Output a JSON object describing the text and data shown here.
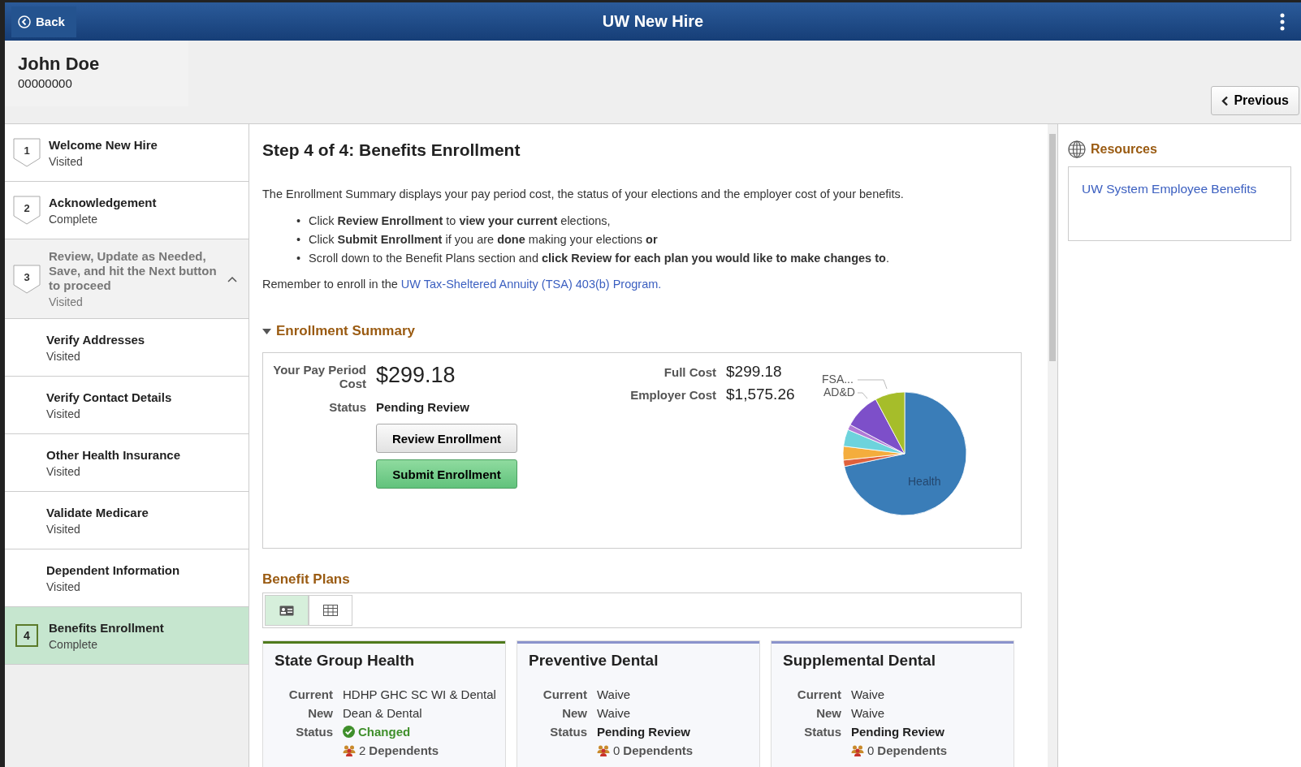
{
  "header": {
    "back": "Back",
    "title": "UW New Hire"
  },
  "person": {
    "name": "John Doe",
    "id": "00000000"
  },
  "previous": "Previous",
  "steps": [
    {
      "number": "1",
      "title": "Welcome New Hire",
      "status": "Visited",
      "selected": false,
      "expanded": false
    },
    {
      "number": "2",
      "title": "Acknowledgement",
      "status": "Complete",
      "selected": false,
      "expanded": false
    },
    {
      "number": "3",
      "title": "Review, Update as Needed, Save, and hit the Next button to proceed",
      "status": "Visited",
      "selected": false,
      "expanded": true,
      "children": [
        {
          "title": "Verify Addresses",
          "status": "Visited",
          "selected": false
        },
        {
          "title": "Verify Contact Details",
          "status": "Visited",
          "selected": false
        },
        {
          "title": "Other Health Insurance",
          "status": "Visited",
          "selected": false
        },
        {
          "title": "Validate Medicare",
          "status": "Visited",
          "selected": false
        },
        {
          "title": "Dependent Information",
          "status": "Visited",
          "selected": false
        }
      ]
    },
    {
      "number": "4",
      "title": "Benefits Enrollment",
      "status": "Complete",
      "selected": true,
      "expanded": false
    }
  ],
  "main": {
    "title": "Step 4 of 4: Benefits Enrollment",
    "intro": "The Enrollment Summary displays your pay period cost, the status of your elections and the employer cost of your benefits.",
    "bullets": [
      {
        "marker": "•",
        "text": "Click **Review Enrollment** to **view your current** elections,"
      },
      {
        "marker": "•",
        "text": "Click **Submit Enrollment** if you are **done** making your elections **or**"
      },
      {
        "marker": "•",
        "text": "Scroll down to the Benefit Plans section and **click Review for each plan you would like to make changes to**."
      }
    ],
    "reminder": "Remember to enroll in the",
    "reminder_link": "UW Tax-Sheltered Annuity (TSA) 403(b) Program.",
    "summary": {
      "heading": "Enrollment Summary",
      "expanded": true,
      "pay_label": "Your Pay Period Cost",
      "pay_value": "$299.18",
      "status_label": "Status",
      "status_value": "Pending Review",
      "review_button": "Review Enrollment",
      "submit_button": "Submit Enrollment",
      "full_label": "Full Cost",
      "full_value": "$299.18",
      "employer_label": "Employer Cost",
      "employer_value": "$1,575.26",
      "pie_labels": [
        "FSA...",
        "AD&D",
        "Health"
      ]
    },
    "plans_heading": "Benefit Plans",
    "views": [
      {
        "kind": "cards",
        "selected": true
      },
      {
        "kind": "grid",
        "selected": false
      }
    ],
    "plans": [
      {
        "name": "State Group Health",
        "color": "#4f7a1c",
        "current_label": "Current",
        "current": "HDHP GHC SC WI & Dental",
        "new_label": "New",
        "new": "Dean & Dental",
        "status_label": "Status",
        "kind": "changed",
        "status": "Changed",
        "dependents_count": "2",
        "dependents": "Dependents"
      },
      {
        "name": "Preventive Dental",
        "color": "#8a93cc",
        "current_label": "Current",
        "current": "Waive",
        "new_label": "New",
        "new": "Waive",
        "status_label": "Status",
        "kind": "pending",
        "status": "Pending Review",
        "dependents_count": "0",
        "dependents": "Dependents"
      },
      {
        "name": "Supplemental Dental",
        "color": "#8a93cc",
        "current_label": "Current",
        "current": "Waive",
        "new_label": "New",
        "new": "Waive",
        "status_label": "Status",
        "kind": "pending",
        "status": "Pending Review",
        "dependents_count": "0",
        "dependents": "Dependents"
      }
    ]
  },
  "resources": {
    "heading": "Resources",
    "links": [
      "UW System Employee Benefits"
    ]
  }
}
